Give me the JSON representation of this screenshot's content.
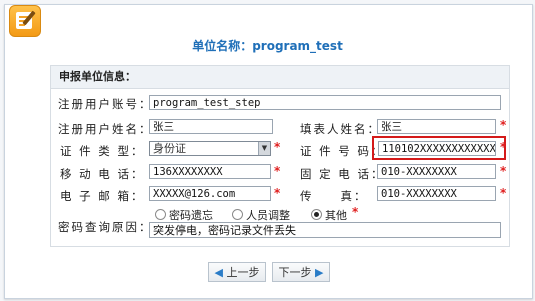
{
  "page_title": "单位名称：program_test",
  "section_title": "申报单位信息：",
  "labels": {
    "account": "注册用户账号：",
    "name": "注册用户姓名：",
    "filler": "填表人姓名：",
    "id_type": "证 件 类 型：",
    "id_no": "证 件 号 码：",
    "mobile": "移 动 电 话：",
    "phone": "固 定 电 话：",
    "email": "电 子 邮 箱：",
    "fax": "传　　真：",
    "reason": "密码查询原因："
  },
  "values": {
    "account": "program_test_step",
    "name": "张三",
    "filler": "张三",
    "id_type": "身份证",
    "id_no": "110102XXXXXXXXXXXX",
    "mobile": "136XXXXXXXX",
    "phone": "010-XXXXXXXX",
    "email": "XXXXX@126.com",
    "fax": "010-XXXXXXXX",
    "reason_text": "突发停电，密码记录文件丢失"
  },
  "required_mark": "*",
  "reasons": [
    "密码遗忘",
    "人员调整",
    "其他"
  ],
  "selected_reason": "其他",
  "buttons": {
    "prev": "上一步",
    "next": "下一步"
  },
  "icons": {
    "prev": "◆",
    "next": "◆"
  },
  "colors": {
    "title": "#1f6fb8",
    "required": "#e02020",
    "highlight": "#d41a1a"
  }
}
